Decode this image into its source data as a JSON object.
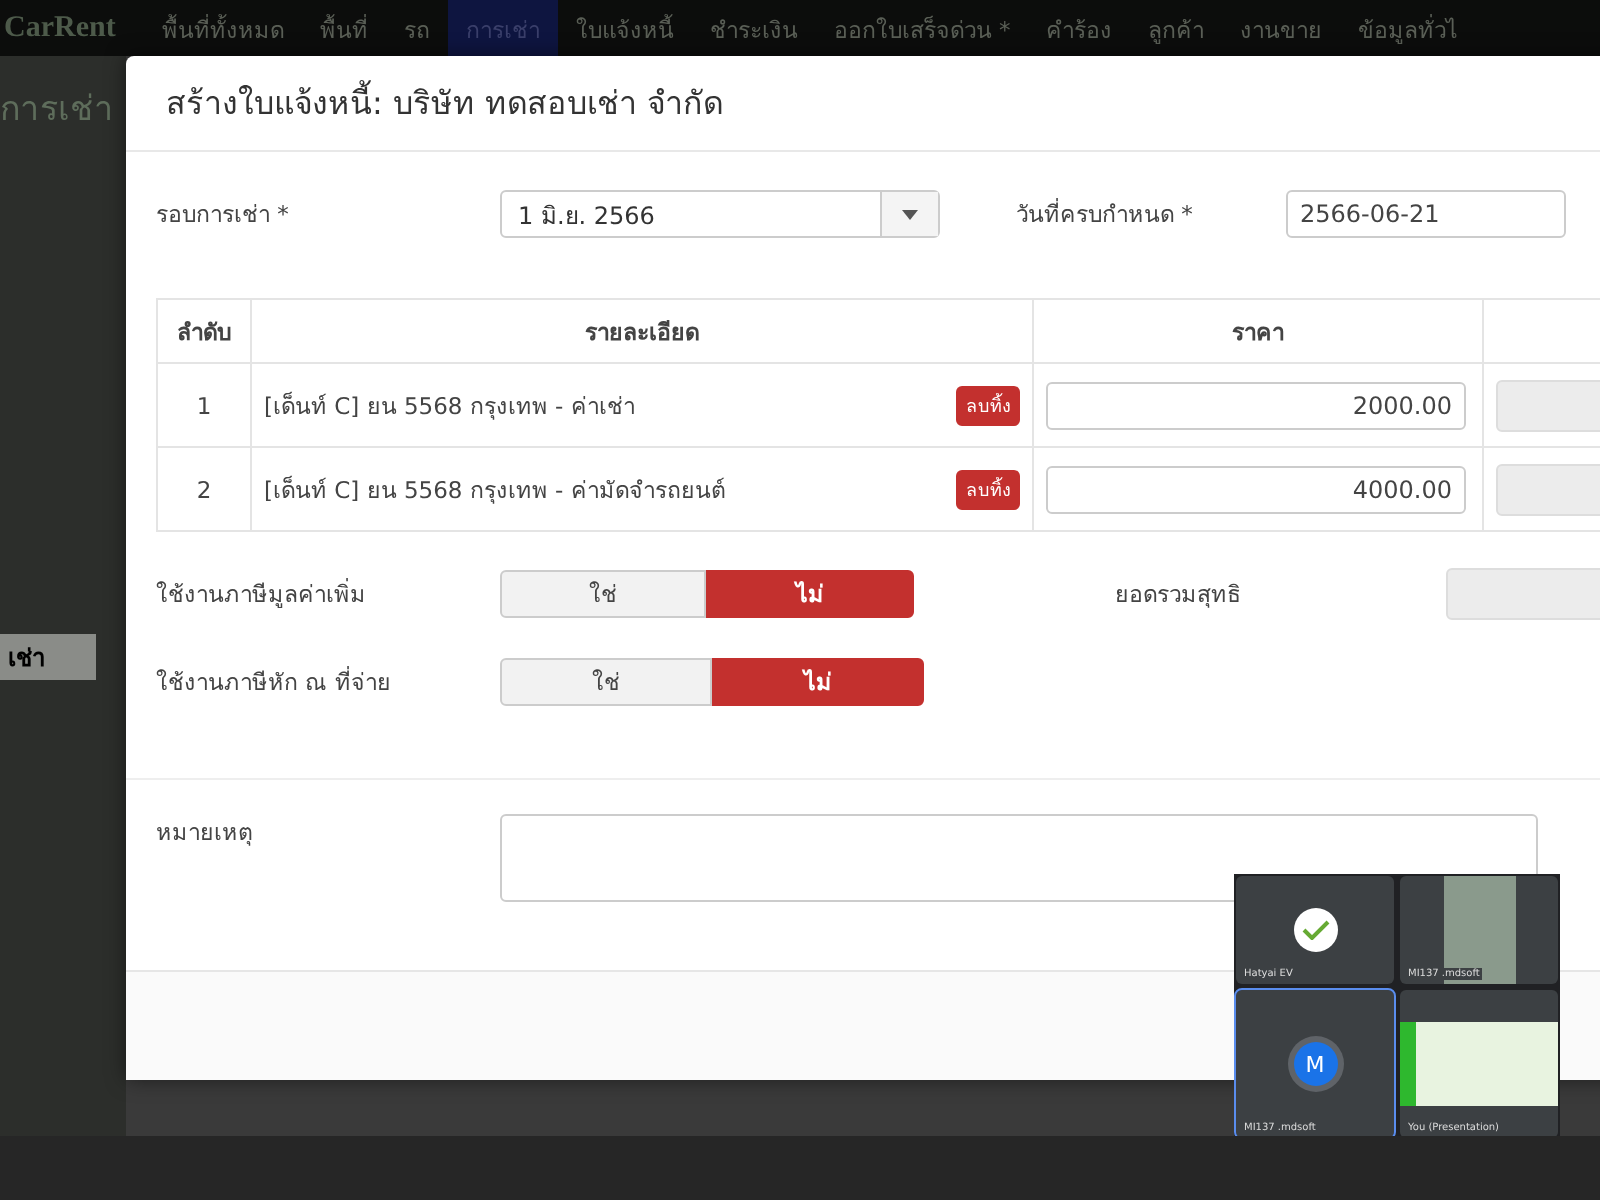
{
  "navbar": {
    "brand": "CarRent",
    "items": [
      {
        "label": "พื้นที่ทั้งหมด",
        "selected": false
      },
      {
        "label": "พื้นที่",
        "selected": false
      },
      {
        "label": "รถ",
        "selected": false
      },
      {
        "label": "การเช่า",
        "selected": true
      },
      {
        "label": "ใบแจ้งหนี้",
        "selected": false
      },
      {
        "label": "ชำระเงิน",
        "selected": false
      },
      {
        "label": "ออกใบเสร็จด่วน *",
        "selected": false
      },
      {
        "label": "คำร้อง",
        "selected": false
      },
      {
        "label": "ลูกค้า",
        "selected": false
      },
      {
        "label": "งานขาย",
        "selected": false
      },
      {
        "label": "ข้อมูลทั่วไ",
        "selected": false
      }
    ]
  },
  "background": {
    "page_title": "การเช่า",
    "sidebar_item": "เช่า"
  },
  "modal": {
    "title": "สร้างใบแจ้งหนี้: บริษัท ทดสอบเช่า จำกัด",
    "rental_period": {
      "label": "รอบการเช่า *",
      "value": "1 มิ.ย. 2566"
    },
    "due_date": {
      "label": "วันที่ครบกำหนด *",
      "value": "2566-06-21"
    },
    "table": {
      "columns": [
        "ลำดับ",
        "รายละเอียด",
        "ราคา"
      ],
      "rows": [
        {
          "no": "1",
          "detail": "[เด็นท์ C] ยน 5568 กรุงเทพ - ค่าเช่า",
          "delete": "ลบทิ้ง",
          "price": "2000.00"
        },
        {
          "no": "2",
          "detail": "[เด็นท์ C] ยน 5568 กรุงเทพ - ค่ามัดจำรถยนต์",
          "delete": "ลบทิ้ง",
          "price": "4000.00"
        }
      ]
    },
    "toggles": [
      {
        "label": "ใช้งานภาษีมูลค่าเพิ่ม",
        "options": [
          {
            "label": "ใช่",
            "selected": false
          },
          {
            "label": "ไม่",
            "selected": true
          }
        ]
      },
      {
        "label": "ใช้งานภาษีหัก ณ ที่จ่าย",
        "options": [
          {
            "label": "ใช่",
            "selected": false
          },
          {
            "label": "ไม่",
            "selected": true
          }
        ]
      }
    ],
    "net_total": {
      "label": "ยอดรวมสุทธิ"
    },
    "notes": {
      "label": "หมายเหตุ"
    }
  },
  "video_call": {
    "tiles": [
      {
        "kind": "logo",
        "name": "Hatyai EV"
      },
      {
        "kind": "camera",
        "name": "MI137 .mdsoft"
      },
      {
        "kind": "avatar",
        "name": "MI137 .mdsoft",
        "letter": "M"
      },
      {
        "kind": "screen",
        "name": "You (Presentation)"
      }
    ]
  }
}
